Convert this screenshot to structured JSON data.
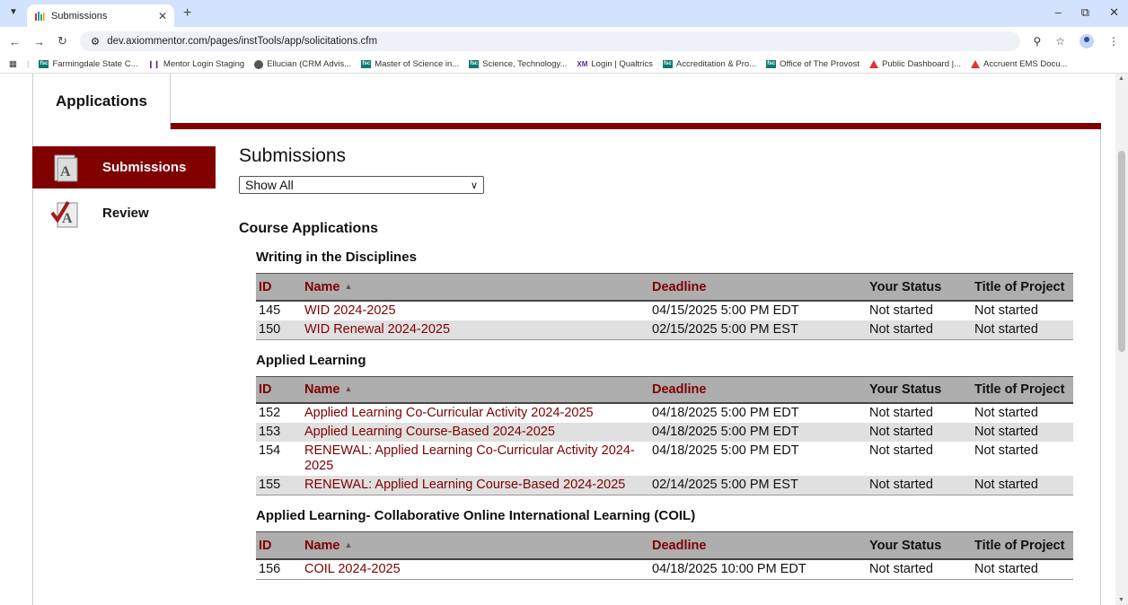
{
  "browser": {
    "tab_title": "Submissions",
    "url": "dev.axiommentor.com/pages/instTools/app/solicitations.cfm",
    "bookmarks": [
      {
        "label": "Farmingdale State C...",
        "icon": "fsc-icon"
      },
      {
        "label": "Mentor Login Staging",
        "icon": "mentor-icon"
      },
      {
        "label": "Ellucian (CRM Advis...",
        "icon": "globe-icon"
      },
      {
        "label": "Master of Science in...",
        "icon": "fsc-icon"
      },
      {
        "label": "Science, Technology...",
        "icon": "fsc-icon"
      },
      {
        "label": "Login | Qualtrics",
        "icon": "qualtrics-icon"
      },
      {
        "label": "Accreditation & Pro...",
        "icon": "fsc-icon"
      },
      {
        "label": "Office of The Provost",
        "icon": "fsc-icon"
      },
      {
        "label": "Public Dashboard |...",
        "icon": "accruent-icon"
      },
      {
        "label": "Accruent EMS Docu...",
        "icon": "accruent-icon"
      }
    ]
  },
  "app": {
    "main_tab": "Applications",
    "nav": [
      {
        "label": "Submissions",
        "active": true
      },
      {
        "label": "Review",
        "active": false
      }
    ],
    "page_title": "Submissions",
    "filter_value": "Show All",
    "section_title": "Course Applications",
    "columns": [
      "ID",
      "Name",
      "Deadline",
      "Your Status",
      "Title of Project"
    ],
    "groups": [
      {
        "title": "Writing in the Disciplines",
        "rows": [
          {
            "id": "145",
            "name": "WID 2024-2025",
            "deadline": "04/15/2025 5:00 PM EDT",
            "status": "Not started",
            "project": "Not started"
          },
          {
            "id": "150",
            "name": "WID Renewal 2024-2025",
            "deadline": "02/15/2025 5:00 PM EST",
            "status": "Not started",
            "project": "Not started"
          }
        ]
      },
      {
        "title": "Applied Learning",
        "rows": [
          {
            "id": "152",
            "name": "Applied Learning Co-Curricular Activity 2024-2025",
            "deadline": "04/18/2025 5:00 PM EDT",
            "status": "Not started",
            "project": "Not started"
          },
          {
            "id": "153",
            "name": "Applied Learning Course-Based 2024-2025",
            "deadline": "04/18/2025 5:00 PM EDT",
            "status": "Not started",
            "project": "Not started"
          },
          {
            "id": "154",
            "name": "RENEWAL: Applied Learning Co-Curricular Activity 2024-2025",
            "deadline": "04/18/2025 5:00 PM EDT",
            "status": "Not started",
            "project": "Not started"
          },
          {
            "id": "155",
            "name": "RENEWAL: Applied Learning Course-Based 2024-2025",
            "deadline": "02/14/2025 5:00 PM EST",
            "status": "Not started",
            "project": "Not started"
          }
        ]
      },
      {
        "title": "Applied Learning- Collaborative Online International Learning (COIL)",
        "rows": [
          {
            "id": "156",
            "name": "COIL 2024-2025",
            "deadline": "04/18/2025 10:00 PM EDT",
            "status": "Not started",
            "project": "Not started"
          }
        ]
      }
    ]
  },
  "colors": {
    "maroon": "#800000",
    "header_gray": "#aeaeae",
    "row_alt": "#e0e0e0"
  }
}
